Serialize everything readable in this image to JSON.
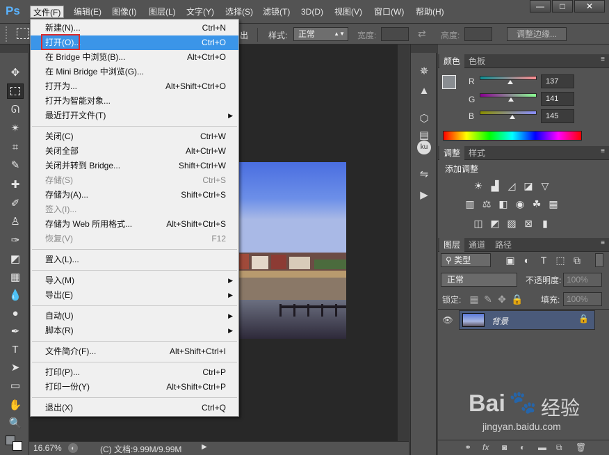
{
  "app": {
    "logo": "Ps"
  },
  "menubar": [
    "文件(F)",
    "编辑(E)",
    "图像(I)",
    "图层(L)",
    "文字(Y)",
    "选择(S)",
    "滤镜(T)",
    "3D(D)",
    "视图(V)",
    "窗口(W)",
    "帮助(H)"
  ],
  "window_controls": {
    "min": "—",
    "max": "□",
    "close": "✕"
  },
  "options": {
    "partial_label": "出",
    "style_label": "样式:",
    "style_value": "正常",
    "width_label": "宽度:",
    "height_label": "高度:",
    "refine_button": "调整边缘..."
  },
  "file_menu": [
    {
      "label": "新建(N)...",
      "shortcut": "Ctrl+N"
    },
    {
      "label": "打开(O)...",
      "shortcut": "Ctrl+O",
      "highlighted": true
    },
    {
      "label": "在 Bridge 中浏览(B)...",
      "shortcut": "Alt+Ctrl+O"
    },
    {
      "label": "在 Mini Bridge 中浏览(G)...",
      "shortcut": ""
    },
    {
      "label": "打开为...",
      "shortcut": "Alt+Shift+Ctrl+O"
    },
    {
      "label": "打开为智能对象...",
      "shortcut": ""
    },
    {
      "label": "最近打开文件(T)",
      "shortcut": "",
      "submenu": true
    },
    {
      "separator": true
    },
    {
      "label": "关闭(C)",
      "shortcut": "Ctrl+W"
    },
    {
      "label": "关闭全部",
      "shortcut": "Alt+Ctrl+W"
    },
    {
      "label": "关闭并转到 Bridge...",
      "shortcut": "Shift+Ctrl+W"
    },
    {
      "label": "存储(S)",
      "shortcut": "Ctrl+S",
      "disabled": true
    },
    {
      "label": "存储为(A)...",
      "shortcut": "Shift+Ctrl+S"
    },
    {
      "label": "签入(I)...",
      "shortcut": "",
      "disabled": true
    },
    {
      "label": "存储为 Web 所用格式...",
      "shortcut": "Alt+Shift+Ctrl+S"
    },
    {
      "label": "恢复(V)",
      "shortcut": "F12",
      "disabled": true
    },
    {
      "separator": true
    },
    {
      "label": "置入(L)...",
      "shortcut": ""
    },
    {
      "separator": true
    },
    {
      "label": "导入(M)",
      "shortcut": "",
      "submenu": true
    },
    {
      "label": "导出(E)",
      "shortcut": "",
      "submenu": true
    },
    {
      "separator": true
    },
    {
      "label": "自动(U)",
      "shortcut": "",
      "submenu": true
    },
    {
      "label": "脚本(R)",
      "shortcut": "",
      "submenu": true
    },
    {
      "separator": true
    },
    {
      "label": "文件简介(F)...",
      "shortcut": "Alt+Shift+Ctrl+I"
    },
    {
      "separator": true
    },
    {
      "label": "打印(P)...",
      "shortcut": "Ctrl+P"
    },
    {
      "label": "打印一份(Y)",
      "shortcut": "Alt+Shift+Ctrl+P"
    },
    {
      "separator": true
    },
    {
      "label": "退出(X)",
      "shortcut": "Ctrl+Q"
    }
  ],
  "color_panel": {
    "tabs": [
      "颜色",
      "色板"
    ],
    "r_label": "R",
    "r_value": "137",
    "g_label": "G",
    "g_value": "141",
    "b_label": "B",
    "b_value": "145",
    "r_fraction": 0.537,
    "g_fraction": 0.553,
    "b_fraction": 0.569,
    "foreground": "#898d91"
  },
  "adjust_panel": {
    "tabs": [
      "调整",
      "样式"
    ],
    "title": "添加调整"
  },
  "layers_panel": {
    "tabs": [
      "图层",
      "通道",
      "路径"
    ],
    "kind_filter": "类型",
    "blend_mode": "正常",
    "opacity_label": "不透明度:",
    "opacity_value": "100%",
    "lock_label": "锁定:",
    "fill_label": "填充:",
    "fill_value": "100%",
    "layer_name": "背景"
  },
  "status": {
    "zoom": "16.67%",
    "doc": "(C) 文档:9.99M/9.99M"
  },
  "watermark": {
    "brand": "Bai",
    "brand2": "经验",
    "url": "jingyan.baidu.com"
  },
  "colors": {
    "accent": "#3b95e8",
    "highlight_box": "#e02a2a"
  }
}
